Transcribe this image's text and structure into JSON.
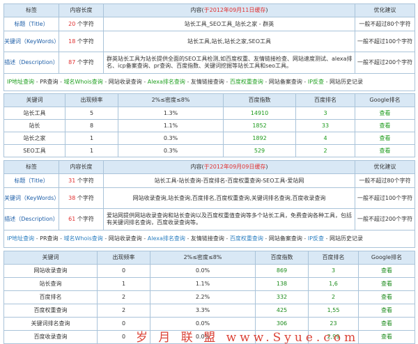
{
  "block1": {
    "headers": [
      "标签",
      "内容长度",
      "内容",
      "优化建议"
    ],
    "content_header_prefix": "内容(",
    "content_header_date": "于2012年09月11日缓存",
    "content_header_suffix": ")",
    "rows": [
      {
        "label": "标题（Title）",
        "len": "20",
        "unit": "个字符",
        "content": "站长工具_SEO工具_站长之家 - 群英",
        "advice": "一般不超过80个字符"
      },
      {
        "label": "关键词（KeyWords）",
        "len": "18",
        "unit": "个字符",
        "content": "站长工具,站长,站长之家,SEO工具",
        "advice": "一般不超过100个字符"
      },
      {
        "label": "描述（Description）",
        "len": "87",
        "unit": "个字符",
        "content": "群英站长工具为站长提供全面的SEO工具检测,如百度权重、友情链接检查、网站速度测试、alexa排名、icp备案查询、pr查询、百度指数、关键词挖掘等站长工具和seo工具。",
        "advice": "一般不超过200个字符"
      }
    ],
    "links": [
      {
        "text": "IP地址查询",
        "c": "ltgreen"
      },
      {
        "text": "PR查询",
        "c": "dark"
      },
      {
        "text": "域名Whois查询",
        "c": "ltgreen"
      },
      {
        "text": "网站收录查询",
        "c": "dark"
      },
      {
        "text": "Alexa排名查询",
        "c": "ltgreen"
      },
      {
        "text": "友情链接查询",
        "c": "dark"
      },
      {
        "text": "百度权重查询",
        "c": "ltgreen"
      },
      {
        "text": "网站备案查询",
        "c": "dark"
      },
      {
        "text": "IP反查",
        "c": "ltgreen"
      },
      {
        "text": "网站历史记录",
        "c": "dark"
      }
    ]
  },
  "kw1": {
    "headers": [
      "关键词",
      "出现频率",
      "2%≤密度≤8%",
      "百度指数",
      "百度排名",
      "Google排名"
    ],
    "rows": [
      {
        "kw": "站长工具",
        "freq": "5",
        "density": "1.3%",
        "index": "14910",
        "rank": "3",
        "google": "查看"
      },
      {
        "kw": "站长",
        "freq": "8",
        "density": "1.1%",
        "index": "1852",
        "rank": "33",
        "google": "查看"
      },
      {
        "kw": "站长之家",
        "freq": "1",
        "density": "0.3%",
        "index": "1892",
        "rank": "4",
        "google": "查看"
      },
      {
        "kw": "SEO工具",
        "freq": "1",
        "density": "0.3%",
        "index": "529",
        "rank": "2",
        "google": "查看"
      }
    ]
  },
  "block2": {
    "headers": [
      "标签",
      "内容长度",
      "内容",
      "优化建议"
    ],
    "content_header_prefix": "内容(",
    "content_header_date": "于2012年09月09日缓存",
    "content_header_suffix": ")",
    "rows": [
      {
        "label": "标题（Title）",
        "len": "31",
        "unit": "个字符",
        "content": "站长工具-站长查询-百度排名-百度权重查询-SEO工具-爱站网",
        "advice": "一般不超过80个字符"
      },
      {
        "label": "关键词（KeyWords）",
        "len": "38",
        "unit": "个字符",
        "content": "网站收录查询,站长查询,百度排名,百度权重查询,关键词排名查询,百度收录查询",
        "advice": "一般不超过100个字符"
      },
      {
        "label": "描述（Description）",
        "len": "61",
        "unit": "个字符",
        "content": "爱站网提供网站收录查询和站长查询以及百度权重值查询等多个站长工具，免费查询各种工具，包括有关键词排名查询，百度收录查询等。",
        "advice": "一般不超过200个字符"
      }
    ],
    "links": [
      {
        "text": "IP地址查询",
        "c": "ltblue"
      },
      {
        "text": "PR查询",
        "c": "dark"
      },
      {
        "text": "域名Whois查询",
        "c": "ltblue"
      },
      {
        "text": "网站收录查询",
        "c": "dark"
      },
      {
        "text": "Alexa排名查询",
        "c": "ltblue"
      },
      {
        "text": "友情链接查询",
        "c": "dark"
      },
      {
        "text": "百度权重查询",
        "c": "ltblue"
      },
      {
        "text": "网站备案查询",
        "c": "dark"
      },
      {
        "text": "IP反查",
        "c": "ltblue"
      },
      {
        "text": "网站历史记录",
        "c": "dark"
      }
    ]
  },
  "kw2": {
    "headers": [
      "关键词",
      "出现频率",
      "2%≤密度≤8%",
      "百度指数",
      "百度排名",
      "Google排名"
    ],
    "rows": [
      {
        "kw": "网站收录查询",
        "freq": "0",
        "density": "0.0%",
        "index": "869",
        "rank": "3",
        "google": "查看"
      },
      {
        "kw": "站长查询",
        "freq": "1",
        "density": "1.1%",
        "index": "138",
        "rank": "1,6",
        "google": "查看"
      },
      {
        "kw": "百度排名",
        "freq": "2",
        "density": "2.2%",
        "index": "332",
        "rank": "2",
        "google": "查看"
      },
      {
        "kw": "百度权重查询",
        "freq": "2",
        "density": "3.3%",
        "index": "425",
        "rank": "1,55",
        "google": "查看"
      },
      {
        "kw": "关键词排名查询",
        "freq": "0",
        "density": "0.0%",
        "index": "306",
        "rank": "23",
        "google": "查看"
      },
      {
        "kw": "百度收录查询",
        "freq": "0",
        "density": "0.0%",
        "index": "",
        "rank": "2,99",
        "google": "查看"
      }
    ]
  },
  "watermark": "岁 月 联 盟  www.Syue.com",
  "colors": {
    "header_bg": "#d9e8f5",
    "border": "#a9c3d9",
    "label_blue": "#1e5fa8",
    "red": "#e03030",
    "green": "#1a9a1a",
    "watermark": "#d83226"
  }
}
